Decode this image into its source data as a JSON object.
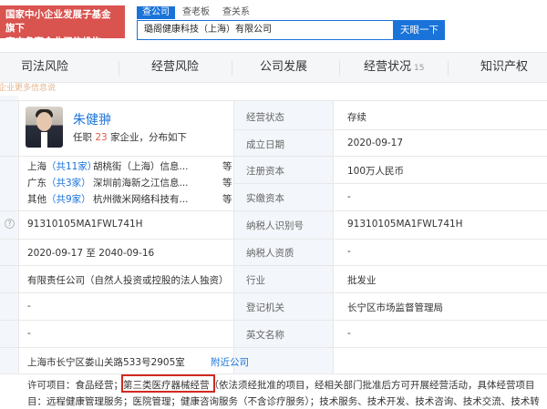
{
  "badge": {
    "line1": "国家中小企业发展子基金旗下",
    "line2": "官方备案企业征信机构"
  },
  "search": {
    "tabs": [
      "查公司",
      "查老板",
      "查关系"
    ],
    "value": "璐阁健康科技（上海）有限公司",
    "button": "天眼一下"
  },
  "nav": {
    "items": [
      {
        "label": "司法风险",
        "count": ""
      },
      {
        "label": "经营风险",
        "count": ""
      },
      {
        "label": "公司发展",
        "count": ""
      },
      {
        "label": "经营状况",
        "count": "15"
      },
      {
        "label": "知识产权",
        "count": ""
      }
    ],
    "faint_text": "企业更多信息说"
  },
  "person": {
    "name": "朱健翀",
    "summary_prefix": "任职",
    "summary_count": "23",
    "summary_suffix": "家企业，分布如下",
    "regions": [
      {
        "region": "上海",
        "count": "（共11家）",
        "company": "胡桃街（上海）信息...",
        "more": "等"
      },
      {
        "region": "广东",
        "count": "（共3家）",
        "company": "深圳前海新之江信息...",
        "more": "等"
      },
      {
        "region": "其他",
        "count": "（共9家）",
        "company": "杭州微米网络科技有...",
        "more": "等"
      }
    ]
  },
  "left": {
    "credit_code": "91310105MA1FWL741H",
    "term_from": "2020-09-17",
    "term_to_sep": "至",
    "term_to": "2040-09-16",
    "company_type": "有限责任公司（自然人投资或控股的法人独资）",
    "dash1": "-",
    "dash2": "-",
    "address": "上海市长宁区娄山关路533号2905室",
    "nearby": "附近公司"
  },
  "right": [
    {
      "label": "经营状态",
      "value": "存续"
    },
    {
      "label": "成立日期",
      "value": "2020-09-17"
    },
    {
      "label": "注册资本",
      "value": "100万人民币"
    },
    {
      "label": "实缴资本",
      "value": "-"
    },
    {
      "label": "纳税人识别号",
      "value": "91310105MA1FWL741H"
    },
    {
      "label": "纳税人资质",
      "value": "-"
    },
    {
      "label": "行业",
      "value": "批发业"
    },
    {
      "label": "登记机关",
      "value": "长宁区市场监督管理局"
    },
    {
      "label": "英文名称",
      "value": "-"
    }
  ],
  "scope": {
    "prefix": "许可项目：食品经营；",
    "highlight": "第三类医疗器械经营",
    "rest1": "（依法须经批准的项目，经相关部门批准后方可开展经营活动，具体经营项目",
    "line2": "目：远程健康管理服务；医院管理；健康咨询服务（不含诊疗服务）；技术服务、技术开发、技术咨询、技术交流、技术转"
  },
  "colors": {
    "accent": "#1a73d9",
    "badge": "#d9534f",
    "highlight_box": "#d12a1f",
    "label_bg": "#f3f6fa"
  }
}
